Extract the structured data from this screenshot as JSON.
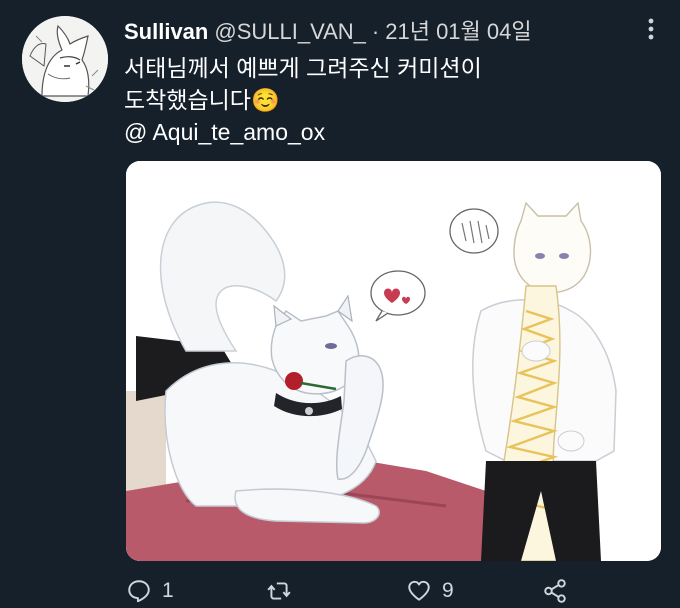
{
  "tweet": {
    "author_name": "Sullivan",
    "author_handle": "@SULLI_VAN_",
    "separator": "·",
    "date": "21년 01월 04일",
    "text_line1": "서태님께서 예쁘게 그려주신 커미션이",
    "text_line2": "도착했습니다",
    "text_emoji": "☺️",
    "mention": "@ Aqui_te_amo_ox",
    "media_alt": "Commissioned illustration"
  },
  "actions": {
    "reply_count": "1",
    "retweet_count": "",
    "like_count": "9",
    "share_count": ""
  },
  "icons": {
    "more": "more-vertical-icon",
    "reply": "reply-icon",
    "retweet": "retweet-icon",
    "like": "heart-icon",
    "share": "share-icon"
  },
  "colors": {
    "background": "#15202b",
    "text": "#ffffff",
    "secondary": "#d7d7d7"
  }
}
